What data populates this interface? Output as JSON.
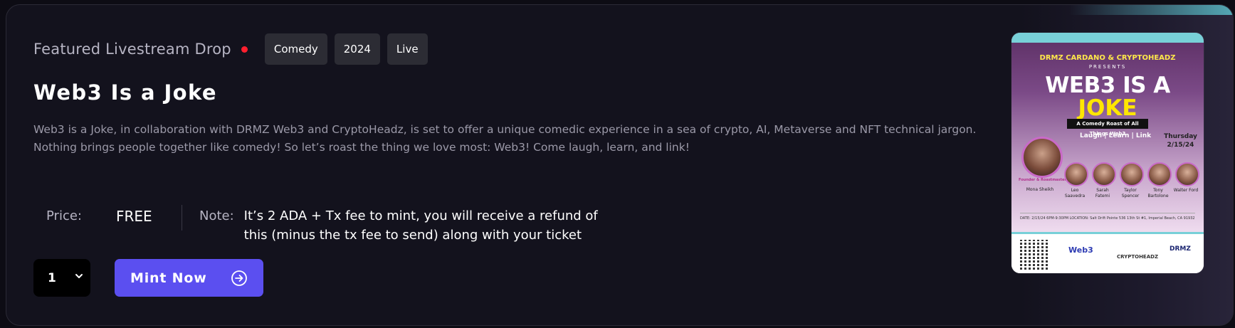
{
  "featured": {
    "eyebrow": "Featured Livestream Drop",
    "tags": [
      "Comedy",
      "2024",
      "Live"
    ]
  },
  "event": {
    "title": "Web3 Is a Joke",
    "description": "Web3 is a Joke, in collaboration with DRMZ Web3 and CryptoHeadz, is set to offer a unique comedic experience in a sea of crypto, AI, Metaverse and NFT technical jargon. Nothing brings people together like comedy! So let’s roast the thing we love most: Web3! Come laugh, learn, and link!"
  },
  "pricing": {
    "price_label": "Price:",
    "price_value": "FREE",
    "note_label": "Note:",
    "note_text": "It’s 2 ADA + Tx fee to mint, you will receive a refund of this (minus the tx fee to send) along with your ticket"
  },
  "mint": {
    "quantity": "1",
    "button_label": "Mint Now"
  },
  "poster": {
    "presents_line": "DRMZ CARDANO & CRYPTOHEADZ",
    "presents_sub": "PRESENTS",
    "title_line1": "WEB3 IS A",
    "title_line2": "JOKE",
    "band": "A Comedy Roast of All Things Web3",
    "tagline": "Laugh | Learn | Link",
    "day": "Thursday",
    "date": "2/15/24",
    "host_label": "Founder & Roastmaster",
    "host_name": "Mona Sheikh",
    "comedians": [
      "Leo Saavedra",
      "Sarah Fatemi",
      "Taylor Spencer",
      "Tony Bartolone",
      "Walter Ford"
    ],
    "info": "DATE: 2/15/24 6PM-9:30PM  LOCATION: Salt Drift Pointe 536 13th St #1, Imperial Beach, CA 91932",
    "sponsors": [
      "Web3",
      "CRYPTOHEADZ",
      "DRMZ"
    ]
  },
  "colors": {
    "accent": "#5b4ff0",
    "live_dot": "#ff1f2e",
    "card_bg": "#13121d"
  }
}
